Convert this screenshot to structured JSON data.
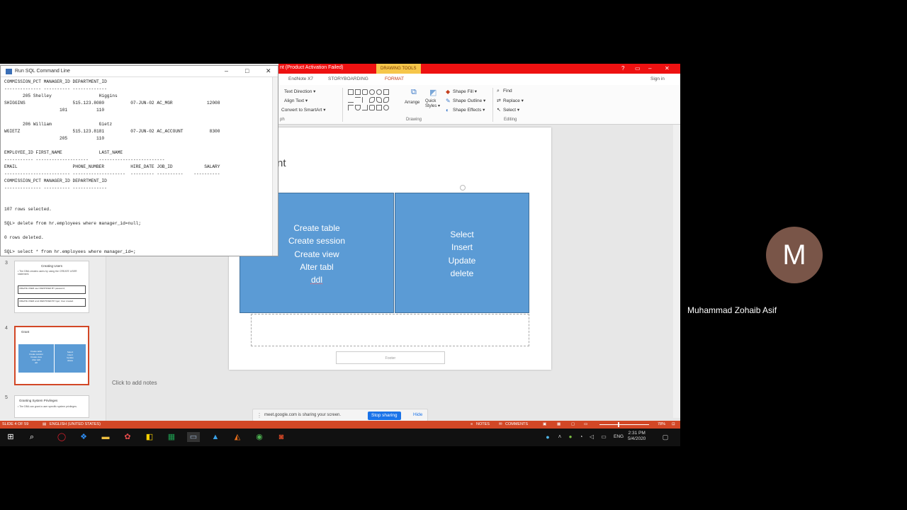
{
  "powerpoint": {
    "title": "nt (Product Activation Failed)",
    "contextual_tab": "DRAWING TOOLS",
    "ribbon_tabs": [
      "EndNote X7",
      "STORYBOARDING",
      "FORMAT"
    ],
    "sign_in": "Sign in",
    "ribbon": {
      "text_direction": "Text Direction ▾",
      "align_text": "Align Text ▾",
      "convert_smartart": "Convert to SmartArt ▾",
      "arrange": "Arrange",
      "quick_styles": "Quick Styles ▾",
      "shape_fill": "Shape Fill ▾",
      "shape_outline": "Shape Outline ▾",
      "shape_effects": "Shape Effects ▾",
      "find": "Find",
      "replace": "Replace ▾",
      "select": "Select ▾",
      "group_paragraph": "ph",
      "group_drawing": "Drawing",
      "group_editing": "Editing"
    },
    "slide_panel": {
      "slides": [
        {
          "number": "3",
          "title": "Creating Users",
          "text": "• The DBA creates users by using the CREATE USER statement.",
          "box1": "CREATE USER user IDENTIFIED BY password;",
          "box2": "CREATE USER scott IDENTIFIED BY tiger; User created."
        },
        {
          "number": "4",
          "title": "Grant",
          "left_lines": [
            "Create table",
            "Create session",
            "Create view",
            "Alter tabl",
            "ddl"
          ],
          "right_lines": [
            "Select",
            "Insert",
            "Update",
            "delete"
          ]
        },
        {
          "number": "5",
          "title": "Granting System Privileges",
          "text": "• The DBA can grant a user specific system privileges."
        }
      ]
    },
    "slide": {
      "title_fragment": "nt",
      "left_box": [
        "Create table",
        "Create session",
        "Create view",
        "Alter tabl",
        "ddl"
      ],
      "right_box": [
        "Select",
        "Insert",
        "Update",
        "delete"
      ],
      "footer": "Footer"
    },
    "notes_hint": "Click to add notes",
    "status": {
      "slide": "SLIDE 4 OF 59",
      "language": "ENGLISH (UNITED STATES)",
      "notes": "NOTES",
      "comments": "COMMENTS",
      "zoom": "78%"
    }
  },
  "sql_window": {
    "title": "Run SQL Command Line",
    "lines": [
      "COMMISSION_PCT MANAGER_ID DEPARTMENT_ID",
      "-------------- ---------- -------------",
      "       205 Shelley                  Higgins",
      "SHIGGINS                  515.123.8080          07-JUN-02 AC_MGR             12008",
      "                     101           110",
      "",
      "       206 William                  Gietz",
      "WGIETZ                    515.123.8181          07-JUN-02 AC_ACCOUNT          8300",
      "                     205           110",
      "",
      "EMPLOYEE_ID FIRST_NAME              LAST_NAME",
      "----------- --------------------    -------------------------",
      "EMAIL                     PHONE_NUMBER          HIRE_DATE JOB_ID            SALARY",
      "------------------------- --------------------  --------- ----------    ----------",
      "COMMISSION_PCT MANAGER_ID DEPARTMENT_ID",
      "-------------- ---------- -------------",
      "",
      "",
      "107 rows selected.",
      "",
      "SQL> delete from hr.employees where manager_id=null;",
      "",
      "0 rows deleted.",
      "",
      "SQL> select * from hr.employees where manager_id=;"
    ]
  },
  "share_bar": {
    "text": "meet.google.com is sharing your screen.",
    "stop": "Stop sharing",
    "hide": "Hide"
  },
  "taskbar": {
    "time": "2:31 PM",
    "date": "5/4/2020",
    "lang": "ENG",
    "icons": [
      "windows-icon",
      "search-icon",
      "opera-icon",
      "dropbox-icon",
      "file-explorer-icon",
      "settings-icon",
      "sticky-notes-icon",
      "excel-icon",
      "terminal-icon",
      "photos-icon",
      "matlab-icon",
      "chrome-icon",
      "powerpoint-icon"
    ]
  },
  "participant": {
    "initial": "M",
    "name": "Muhammad Zohaib Asif",
    "avatar_color": "#795548"
  }
}
